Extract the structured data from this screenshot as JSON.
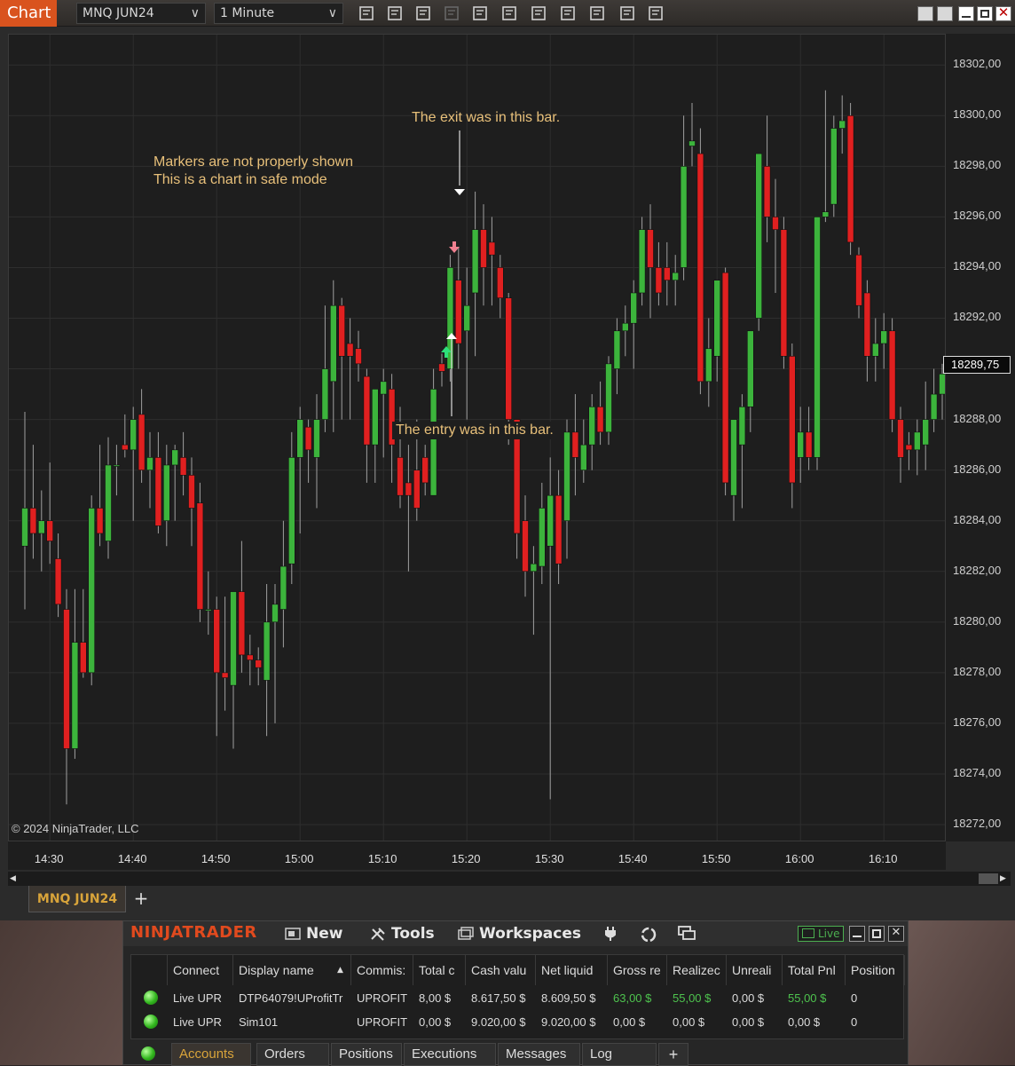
{
  "titlebar": {
    "tab_label": "Chart",
    "instrument": "MNQ JUN24",
    "interval": "1 Minute",
    "tools": [
      "bar-type-icon",
      "draw-pencil-icon",
      "zoom-in-icon",
      "zoom-out-icon",
      "pointer-icon",
      "data-box-icon",
      "properties-icon",
      "indicators-icon",
      "strategies-icon",
      "templates-icon",
      "menu-list-icon"
    ]
  },
  "annotations": {
    "safe_mode_line1": "Markers are not properly shown",
    "safe_mode_line2": "This is a chart in safe mode",
    "exit_note": "The exit was in this bar.",
    "entry_note": "The entry was in this bar."
  },
  "copyright": "© 2024 NinjaTrader, LLC",
  "price_axis": {
    "ticks": [
      "18302,00",
      "18300,00",
      "18298,00",
      "18296,00",
      "18294,00",
      "18292,00",
      "18290,00",
      "18288,00",
      "18286,00",
      "18284,00",
      "18282,00",
      "18280,00",
      "18278,00",
      "18276,00",
      "18274,00",
      "18272,00"
    ],
    "last_price": "18289,75"
  },
  "time_axis": {
    "ticks": [
      "14:30",
      "14:40",
      "14:50",
      "15:00",
      "15:10",
      "15:20",
      "15:30",
      "15:40",
      "15:50",
      "16:00",
      "16:10"
    ]
  },
  "chart_data": {
    "type": "candlestick",
    "instrument": "MNQ JUN24",
    "interval": "1 Minute",
    "ylim": [
      18271.3,
      18303.2
    ],
    "up_color": "#3cb43c",
    "down_color": "#e02020",
    "start_time": "14:27",
    "candles": [
      {
        "t": "14:27",
        "o": 18283.0,
        "h": 18288.3,
        "l": 18280.5,
        "c": 18284.5
      },
      {
        "t": "14:28",
        "o": 18284.5,
        "h": 18287.0,
        "l": 18282.5,
        "c": 18283.5
      },
      {
        "t": "14:29",
        "o": 18283.5,
        "h": 18285.2,
        "l": 18282.0,
        "c": 18284.0
      },
      {
        "t": "14:30",
        "o": 18284.0,
        "h": 18286.3,
        "l": 18282.3,
        "c": 18283.2
      },
      {
        "t": "14:31",
        "o": 18282.5,
        "h": 18283.5,
        "l": 18280.2,
        "c": 18280.7
      },
      {
        "t": "14:32",
        "o": 18280.5,
        "h": 18281.3,
        "l": 18272.8,
        "c": 18275.0
      },
      {
        "t": "14:33",
        "o": 18275.0,
        "h": 18281.3,
        "l": 18274.6,
        "c": 18279.2
      },
      {
        "t": "14:34",
        "o": 18279.2,
        "h": 18281.3,
        "l": 18277.8,
        "c": 18278.0
      },
      {
        "t": "14:35",
        "o": 18278.0,
        "h": 18285.0,
        "l": 18277.5,
        "c": 18284.5
      },
      {
        "t": "14:36",
        "o": 18284.5,
        "h": 18287.0,
        "l": 18283.0,
        "c": 18283.5
      },
      {
        "t": "14:37",
        "o": 18283.2,
        "h": 18287.3,
        "l": 18282.5,
        "c": 18286.2
      },
      {
        "t": "14:38",
        "o": 18286.2,
        "h": 18287.0,
        "l": 18285.0,
        "c": 18286.2
      },
      {
        "t": "14:39",
        "o": 18287.0,
        "h": 18288.2,
        "l": 18286.5,
        "c": 18286.8
      },
      {
        "t": "14:40",
        "o": 18286.8,
        "h": 18288.5,
        "l": 18284.0,
        "c": 18288.0
      },
      {
        "t": "14:41",
        "o": 18288.2,
        "h": 18289.2,
        "l": 18285.5,
        "c": 18286.0
      },
      {
        "t": "14:42",
        "o": 18286.0,
        "h": 18287.5,
        "l": 18284.5,
        "c": 18286.5
      },
      {
        "t": "14:43",
        "o": 18286.5,
        "h": 18287.5,
        "l": 18283.5,
        "c": 18283.8
      },
      {
        "t": "14:44",
        "o": 18284.0,
        "h": 18287.0,
        "l": 18283.0,
        "c": 18286.2
      },
      {
        "t": "14:45",
        "o": 18286.2,
        "h": 18287.0,
        "l": 18284.0,
        "c": 18286.8
      },
      {
        "t": "14:46",
        "o": 18286.5,
        "h": 18287.5,
        "l": 18285.0,
        "c": 18285.8
      },
      {
        "t": "14:47",
        "o": 18285.8,
        "h": 18286.5,
        "l": 18283.0,
        "c": 18284.5
      },
      {
        "t": "14:48",
        "o": 18284.7,
        "h": 18285.5,
        "l": 18280.0,
        "c": 18280.5
      },
      {
        "t": "14:49",
        "o": 18280.5,
        "h": 18282.0,
        "l": 18279.5,
        "c": 18280.5
      },
      {
        "t": "14:50",
        "o": 18280.5,
        "h": 18281.0,
        "l": 18275.5,
        "c": 18278.0
      },
      {
        "t": "14:51",
        "o": 18278.0,
        "h": 18281.0,
        "l": 18276.5,
        "c": 18277.8
      },
      {
        "t": "14:52",
        "o": 18277.5,
        "h": 18281.0,
        "l": 18275.0,
        "c": 18281.2
      },
      {
        "t": "14:53",
        "o": 18281.2,
        "h": 18283.2,
        "l": 18278.0,
        "c": 18278.7
      },
      {
        "t": "14:54",
        "o": 18278.7,
        "h": 18279.5,
        "l": 18277.5,
        "c": 18278.5
      },
      {
        "t": "14:55",
        "o": 18278.5,
        "h": 18279.0,
        "l": 18277.5,
        "c": 18278.2
      },
      {
        "t": "14:56",
        "o": 18277.7,
        "h": 18281.5,
        "l": 18275.5,
        "c": 18280.0
      },
      {
        "t": "14:57",
        "o": 18280.0,
        "h": 18281.5,
        "l": 18276.0,
        "c": 18280.7
      },
      {
        "t": "14:58",
        "o": 18280.5,
        "h": 18284.0,
        "l": 18279.0,
        "c": 18282.2
      },
      {
        "t": "14:59",
        "o": 18282.3,
        "h": 18287.5,
        "l": 18281.5,
        "c": 18286.5
      },
      {
        "t": "15:00",
        "o": 18286.5,
        "h": 18288.5,
        "l": 18283.5,
        "c": 18288.0
      },
      {
        "t": "15:01",
        "o": 18287.7,
        "h": 18288.0,
        "l": 18285.5,
        "c": 18286.8
      },
      {
        "t": "15:02",
        "o": 18286.5,
        "h": 18289.0,
        "l": 18284.5,
        "c": 18288.0
      },
      {
        "t": "15:03",
        "o": 18288.0,
        "h": 18292.5,
        "l": 18287.5,
        "c": 18290.0
      },
      {
        "t": "15:04",
        "o": 18289.5,
        "h": 18293.5,
        "l": 18287.5,
        "c": 18292.5
      },
      {
        "t": "15:05",
        "o": 18292.5,
        "h": 18292.8,
        "l": 18288.0,
        "c": 18290.5
      },
      {
        "t": "15:06",
        "o": 18291.0,
        "h": 18292.0,
        "l": 18288.0,
        "c": 18290.5
      },
      {
        "t": "15:07",
        "o": 18290.8,
        "h": 18291.5,
        "l": 18289.5,
        "c": 18290.2
      },
      {
        "t": "15:08",
        "o": 18289.7,
        "h": 18290.0,
        "l": 18285.5,
        "c": 18287.0
      },
      {
        "t": "15:09",
        "o": 18287.0,
        "h": 18289.0,
        "l": 18285.5,
        "c": 18289.2
      },
      {
        "t": "15:10",
        "o": 18289.0,
        "h": 18290.0,
        "l": 18286.5,
        "c": 18289.5
      },
      {
        "t": "15:11",
        "o": 18289.2,
        "h": 18289.8,
        "l": 18285.5,
        "c": 18287.0
      },
      {
        "t": "15:12",
        "o": 18286.5,
        "h": 18288.5,
        "l": 18284.5,
        "c": 18285.0
      },
      {
        "t": "15:13",
        "o": 18285.5,
        "h": 18287.0,
        "l": 18282.0,
        "c": 18285.0
      },
      {
        "t": "15:14",
        "o": 18286.0,
        "h": 18288.0,
        "l": 18284.0,
        "c": 18284.5
      },
      {
        "t": "15:15",
        "o": 18286.5,
        "h": 18287.0,
        "l": 18285.0,
        "c": 18285.5
      },
      {
        "t": "15:16",
        "o": 18285.0,
        "h": 18290.0,
        "l": 18285.0,
        "c": 18289.2
      },
      {
        "t": "15:17",
        "o": 18290.2,
        "h": 18290.6,
        "l": 18289.3,
        "c": 18289.9
      },
      {
        "t": "15:18",
        "o": 18290.0,
        "h": 18294.5,
        "l": 18289.5,
        "c": 18294.0
      },
      {
        "t": "15:19",
        "o": 18293.5,
        "h": 18294.8,
        "l": 18290.0,
        "c": 18291.0
      },
      {
        "t": "15:20",
        "o": 18291.5,
        "h": 18294.0,
        "l": 18288.0,
        "c": 18292.5
      },
      {
        "t": "15:21",
        "o": 18293.0,
        "h": 18297.0,
        "l": 18290.5,
        "c": 18295.5
      },
      {
        "t": "15:22",
        "o": 18295.5,
        "h": 18296.5,
        "l": 18292.5,
        "c": 18294.0
      },
      {
        "t": "15:23",
        "o": 18295.0,
        "h": 18296.0,
        "l": 18292.5,
        "c": 18294.5
      },
      {
        "t": "15:24",
        "o": 18294.0,
        "h": 18294.5,
        "l": 18292.0,
        "c": 18292.8
      },
      {
        "t": "15:25",
        "o": 18292.8,
        "h": 18293.0,
        "l": 18287.0,
        "c": 18288.0
      },
      {
        "t": "15:26",
        "o": 18288.0,
        "h": 18288.0,
        "l": 18282.5,
        "c": 18283.5
      },
      {
        "t": "15:27",
        "o": 18284.0,
        "h": 18285.0,
        "l": 18281.0,
        "c": 18282.0
      },
      {
        "t": "15:28",
        "o": 18282.0,
        "h": 18283.0,
        "l": 18279.5,
        "c": 18282.3
      },
      {
        "t": "15:29",
        "o": 18282.2,
        "h": 18285.5,
        "l": 18281.5,
        "c": 18284.5
      },
      {
        "t": "15:30",
        "o": 18283.0,
        "h": 18286.5,
        "l": 18273.0,
        "c": 18285.0
      },
      {
        "t": "15:31",
        "o": 18285.0,
        "h": 18286.0,
        "l": 18281.5,
        "c": 18282.3
      },
      {
        "t": "15:32",
        "o": 18284.0,
        "h": 18288.0,
        "l": 18282.5,
        "c": 18287.5
      },
      {
        "t": "15:33",
        "o": 18287.5,
        "h": 18289.0,
        "l": 18285.0,
        "c": 18286.5
      },
      {
        "t": "15:34",
        "o": 18286.0,
        "h": 18288.0,
        "l": 18285.5,
        "c": 18287.0
      },
      {
        "t": "15:35",
        "o": 18287.0,
        "h": 18289.0,
        "l": 18286.0,
        "c": 18288.5
      },
      {
        "t": "15:36",
        "o": 18288.5,
        "h": 18289.5,
        "l": 18287.0,
        "c": 18287.5
      },
      {
        "t": "15:37",
        "o": 18287.5,
        "h": 18290.5,
        "l": 18287.0,
        "c": 18290.2
      },
      {
        "t": "15:38",
        "o": 18290.0,
        "h": 18292.0,
        "l": 18289.0,
        "c": 18291.5
      },
      {
        "t": "15:39",
        "o": 18291.5,
        "h": 18292.5,
        "l": 18290.5,
        "c": 18291.8
      },
      {
        "t": "15:40",
        "o": 18291.8,
        "h": 18293.5,
        "l": 18290.0,
        "c": 18293.0
      },
      {
        "t": "15:41",
        "o": 18293.0,
        "h": 18296.0,
        "l": 18292.5,
        "c": 18295.5
      },
      {
        "t": "15:42",
        "o": 18295.5,
        "h": 18296.5,
        "l": 18292.0,
        "c": 18294.0
      },
      {
        "t": "15:43",
        "o": 18294.0,
        "h": 18295.0,
        "l": 18292.5,
        "c": 18293.0
      },
      {
        "t": "15:44",
        "o": 18294.0,
        "h": 18295.0,
        "l": 18292.5,
        "c": 18293.5
      },
      {
        "t": "15:45",
        "o": 18293.5,
        "h": 18294.5,
        "l": 18292.5,
        "c": 18293.8
      },
      {
        "t": "15:46",
        "o": 18294.0,
        "h": 18300.0,
        "l": 18293.5,
        "c": 18298.0
      },
      {
        "t": "15:47",
        "o": 18298.8,
        "h": 18300.5,
        "l": 18298.0,
        "c": 18299.0
      },
      {
        "t": "15:48",
        "o": 18298.5,
        "h": 18299.5,
        "l": 18289.0,
        "c": 18289.5
      },
      {
        "t": "15:49",
        "o": 18289.5,
        "h": 18292.0,
        "l": 18288.5,
        "c": 18290.8
      },
      {
        "t": "15:50",
        "o": 18290.5,
        "h": 18292.5,
        "l": 18289.5,
        "c": 18293.5
      },
      {
        "t": "15:51",
        "o": 18293.8,
        "h": 18294.0,
        "l": 18285.0,
        "c": 18285.5
      },
      {
        "t": "15:52",
        "o": 18285.0,
        "h": 18288.0,
        "l": 18284.0,
        "c": 18288.0
      },
      {
        "t": "15:53",
        "o": 18287.0,
        "h": 18289.0,
        "l": 18284.5,
        "c": 18288.5
      },
      {
        "t": "15:54",
        "o": 18288.5,
        "h": 18291.5,
        "l": 18287.5,
        "c": 18291.5
      },
      {
        "t": "15:55",
        "o": 18292.0,
        "h": 18298.5,
        "l": 18291.5,
        "c": 18298.5
      },
      {
        "t": "15:56",
        "o": 18298.0,
        "h": 18300.0,
        "l": 18295.0,
        "c": 18296.0
      },
      {
        "t": "15:57",
        "o": 18296.0,
        "h": 18297.5,
        "l": 18293.0,
        "c": 18295.5
      },
      {
        "t": "15:58",
        "o": 18295.5,
        "h": 18296.0,
        "l": 18290.0,
        "c": 18290.5
      },
      {
        "t": "15:59",
        "o": 18290.5,
        "h": 18291.0,
        "l": 18284.5,
        "c": 18285.5
      },
      {
        "t": "16:00",
        "o": 18286.5,
        "h": 18288.5,
        "l": 18285.5,
        "c": 18287.5
      },
      {
        "t": "16:01",
        "o": 18287.5,
        "h": 18288.5,
        "l": 18286.0,
        "c": 18286.5
      },
      {
        "t": "16:02",
        "o": 18286.5,
        "h": 18296.0,
        "l": 18286.0,
        "c": 18296.0
      },
      {
        "t": "16:03",
        "o": 18296.0,
        "h": 18301.0,
        "l": 18295.8,
        "c": 18296.2
      },
      {
        "t": "16:04",
        "o": 18296.5,
        "h": 18300.0,
        "l": 18296.0,
        "c": 18299.5
      },
      {
        "t": "16:05",
        "o": 18299.5,
        "h": 18300.8,
        "l": 18298.5,
        "c": 18299.8
      },
      {
        "t": "16:06",
        "o": 18300.0,
        "h": 18300.5,
        "l": 18294.5,
        "c": 18295.0
      },
      {
        "t": "16:07",
        "o": 18294.5,
        "h": 18294.8,
        "l": 18292.0,
        "c": 18292.5
      },
      {
        "t": "16:08",
        "o": 18293.0,
        "h": 18293.5,
        "l": 18289.5,
        "c": 18290.5
      },
      {
        "t": "16:09",
        "o": 18290.5,
        "h": 18292.0,
        "l": 18289.5,
        "c": 18291.0
      },
      {
        "t": "16:10",
        "o": 18291.0,
        "h": 18292.2,
        "l": 18290.0,
        "c": 18291.5
      },
      {
        "t": "16:11",
        "o": 18291.5,
        "h": 18292.0,
        "l": 18287.5,
        "c": 18288.0
      },
      {
        "t": "16:12",
        "o": 18288.0,
        "h": 18288.5,
        "l": 18285.5,
        "c": 18286.5
      },
      {
        "t": "16:13",
        "o": 18287.0,
        "h": 18287.5,
        "l": 18286.0,
        "c": 18286.8
      },
      {
        "t": "16:14",
        "o": 18286.8,
        "h": 18288.0,
        "l": 18285.8,
        "c": 18287.5
      },
      {
        "t": "16:15",
        "o": 18287.0,
        "h": 18289.5,
        "l": 18286.0,
        "c": 18288.0
      },
      {
        "t": "16:16",
        "o": 18288.0,
        "h": 18290.0,
        "l": 18287.5,
        "c": 18289.0
      },
      {
        "t": "16:17",
        "o": 18289.0,
        "h": 18290.2,
        "l": 18288.0,
        "c": 18289.8
      }
    ]
  },
  "tab_strip": {
    "active_tab": "MNQ JUN24",
    "add_label": "+"
  },
  "control_center": {
    "brand": "NINJATRADER",
    "menu": [
      "New",
      "Tools",
      "Workspaces"
    ],
    "live_label": "Live",
    "columns": [
      "Connect",
      "Display name",
      "Commis:",
      "Total c",
      "Cash valu",
      "Net liquid",
      "Gross re",
      "Realizec",
      "Unreali",
      "Total Pnl",
      "Position"
    ],
    "rows": [
      [
        "Live UPR",
        "DTP64079!UProfitTr",
        "UPROFIT",
        "8,00 $",
        "8.617,50 $",
        "8.609,50 $",
        "63,00 $",
        "55,00 $",
        "0,00 $",
        "55,00 $",
        "0"
      ],
      [
        "Live UPR",
        "Sim101",
        "UPROFIT",
        "0,00 $",
        "9.020,00 $",
        "9.020,00 $",
        "0,00 $",
        "0,00 $",
        "0,00 $",
        "0,00 $",
        "0"
      ]
    ],
    "tabs": [
      "Accounts",
      "Orders",
      "Positions",
      "Executions",
      "Messages",
      "Log"
    ],
    "add_tab": "+"
  }
}
